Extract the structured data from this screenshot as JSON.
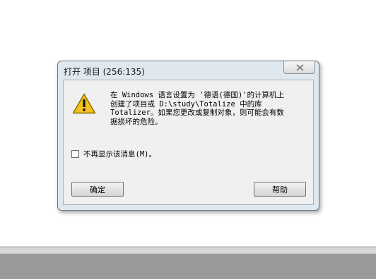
{
  "dialog": {
    "title": "打开 项目 (256:135)",
    "icon": "warning-icon",
    "message": "在 Windows 语言设置为 '德语(德国)'的计算机上\n创建了项目或 D:\\study\\Totalize 中的库\nTotalizer。如果您更改或复制对象，则可能会有数\n据损坏的危险。",
    "checkbox_label": "不再显示该消息(M)。",
    "checkbox_checked": false,
    "ok_label": "确定",
    "help_label": "帮助"
  },
  "colors": {
    "warning_fill": "#f2c21b",
    "warning_border": "#8a6a00",
    "dialog_frame": "#dfe7ef",
    "client_bg": "#f0f0f0"
  }
}
